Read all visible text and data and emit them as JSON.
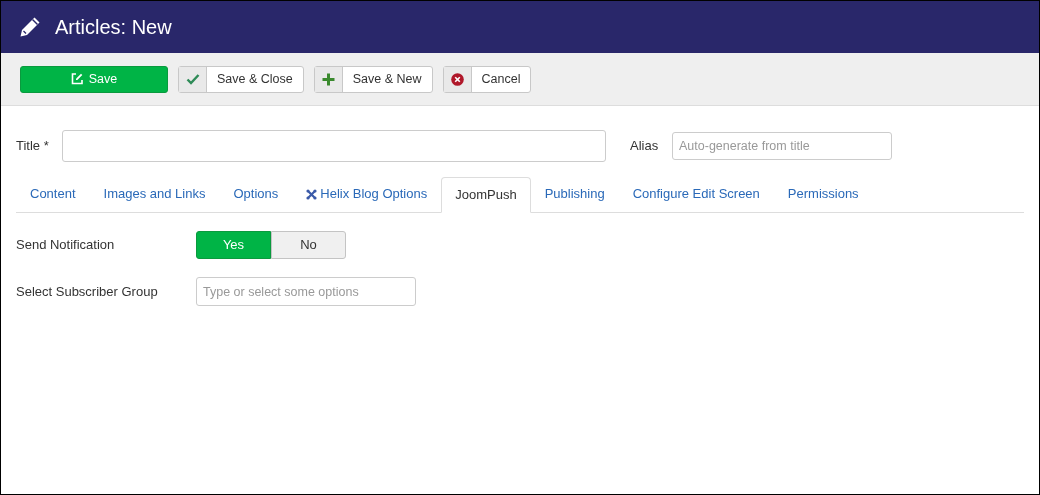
{
  "header": {
    "title": "Articles: New"
  },
  "toolbar": [
    {
      "label": "Save",
      "kind": "primary"
    },
    {
      "label": "Save & Close",
      "kind": "check"
    },
    {
      "label": "Save & New",
      "kind": "plus"
    },
    {
      "label": "Cancel",
      "kind": "cancel"
    }
  ],
  "title_field": {
    "label": "Title *"
  },
  "alias_field": {
    "label": "Alias",
    "placeholder": "Auto-generate from title"
  },
  "tabs": [
    {
      "label": "Content",
      "kind": "plain",
      "selected": false
    },
    {
      "label": "Images and Links",
      "kind": "plain",
      "selected": false
    },
    {
      "label": "Options",
      "kind": "plain",
      "selected": false
    },
    {
      "label": "Helix Blog Options",
      "kind": "icon",
      "selected": false
    },
    {
      "label": "JoomPush",
      "kind": "plain",
      "selected": true
    },
    {
      "label": "Publishing",
      "kind": "plain",
      "selected": false
    },
    {
      "label": "Configure Edit Screen",
      "kind": "plain",
      "selected": false
    },
    {
      "label": "Permissions",
      "kind": "plain",
      "selected": false
    }
  ],
  "send_notification": {
    "label": "Send Notification",
    "options": [
      {
        "label": "Yes",
        "selected": true
      },
      {
        "label": "No",
        "selected": false
      }
    ]
  },
  "subscriber_group": {
    "label": "Select Subscriber Group",
    "placeholder": "Type or select some options"
  }
}
